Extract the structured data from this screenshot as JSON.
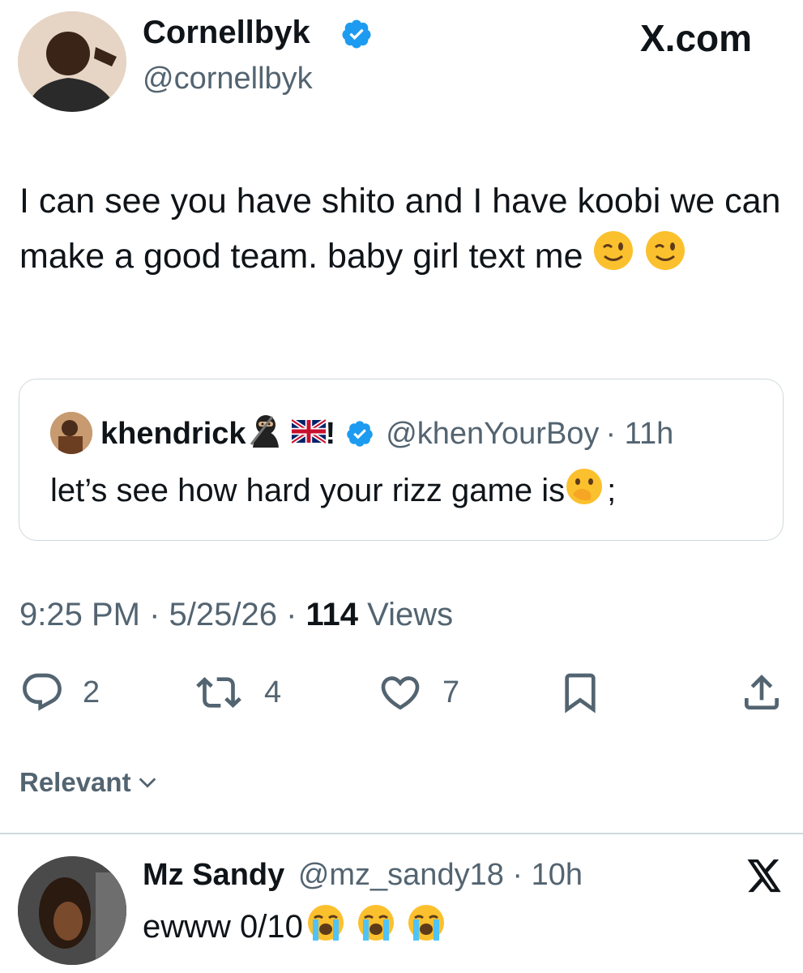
{
  "tweet": {
    "author_name": "Cornellbyk",
    "author_handle": "@cornellbyk",
    "source_label": "X.com",
    "text": "I can see you have shito and I have koobi we can make a good team. baby girl text me",
    "timestamp": "9:25 PM · 5/25/26 · ",
    "views_count": "114",
    "views_label": " Views"
  },
  "quoted": {
    "name": "khendrick",
    "name_suffix": "!",
    "handle": "@khenYourBoy",
    "time": "· 11h",
    "text": "let’s see how hard your rizz game is",
    "text_after_emoji": ";"
  },
  "actions": {
    "replies": "2",
    "reposts": "4",
    "likes": "7"
  },
  "sort": {
    "label": "Relevant"
  },
  "reply": {
    "name": "Mz Sandy",
    "handle": "@mz_sandy18",
    "time": "· 10h",
    "text": "ewww 0/10"
  },
  "colors": {
    "verified": "#1d9bf0",
    "text": "#0f1419",
    "muted": "#536471",
    "border": "#cfd9de"
  },
  "icons": [
    "verified-badge-icon",
    "reply-icon",
    "repost-icon",
    "like-icon",
    "bookmark-icon",
    "share-icon",
    "chevron-down-icon",
    "x-logo-icon"
  ]
}
